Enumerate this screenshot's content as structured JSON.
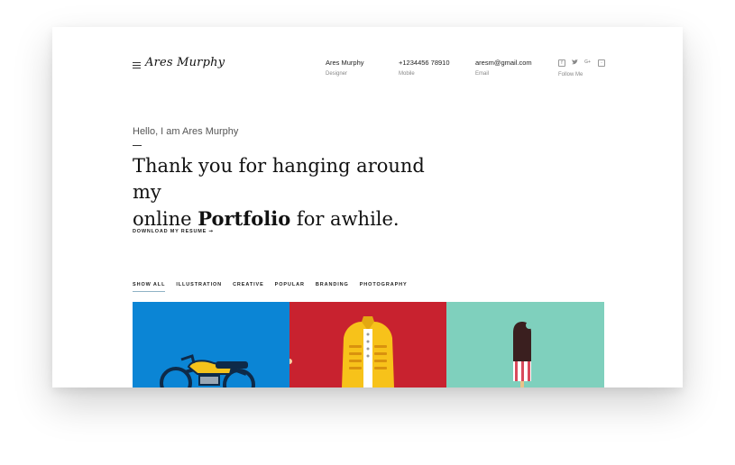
{
  "header": {
    "logo": "Ares Murphy",
    "contacts": [
      {
        "value": "Ares Murphy",
        "label": "Designer"
      },
      {
        "value": "+1234456 78910",
        "label": "Mobile"
      },
      {
        "value": "aresm@gmail.com",
        "label": "Email"
      }
    ],
    "social": {
      "icons": [
        "facebook-icon",
        "twitter-icon",
        "google-plus-icon",
        "instagram-icon"
      ],
      "label": "Follow Me"
    }
  },
  "hero": {
    "greeting": "Hello, I am Ares Murphy",
    "headline_line1": "Thank you for hanging around my",
    "headline_pre": "online ",
    "headline_bold": "Portfolio",
    "headline_post": " for awhile.",
    "resume_link": "DOWNLOAD MY RESUME ➞"
  },
  "filters": [
    "SHOW ALL",
    "ILLUSTRATION",
    "CREATIVE",
    "POPULAR",
    "BRANDING",
    "PHOTOGRAPHY"
  ],
  "gallery": {
    "colors": [
      "#0b85d5",
      "#c8222f",
      "#7fd0bd"
    ]
  }
}
